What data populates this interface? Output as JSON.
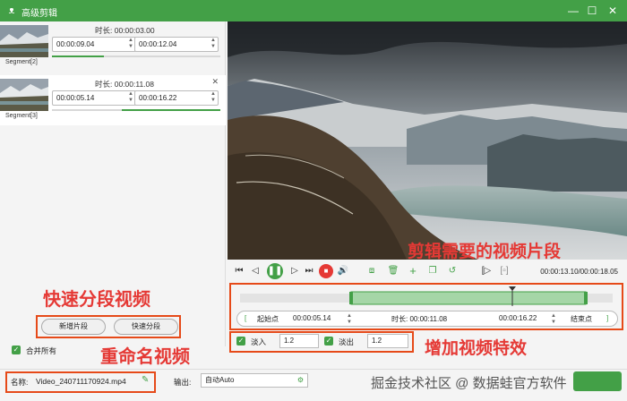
{
  "window": {
    "title": "高级剪辑",
    "minimize_icon": "minimize-icon",
    "maximize_icon": "maximize-icon",
    "close_icon": "close-icon"
  },
  "segments": [
    {
      "label": "Segment[2]",
      "duration_label": "时长: 00:00:03.00",
      "start": "00:00:09.04",
      "end": "00:00:12.04"
    },
    {
      "label": "Segment[3]",
      "duration_label": "时长: 00:00:11.08",
      "start": "00:00:05.14",
      "end": "00:00:16.22"
    }
  ],
  "left_actions": {
    "add_segment": "新增片段",
    "quick_segment": "快速分段",
    "merge_all": "合并所有"
  },
  "annotations": {
    "quick_segment": "快速分段视频",
    "rename": "重命名视频",
    "cut_segment": "剪辑需要的视频片段",
    "add_effects": "增加视频特效",
    "watermark": "掘金技术社区 @ 数据蛙官方软件"
  },
  "player": {
    "time_readout": "00:00:13.10/00:00:18.05"
  },
  "range": {
    "start_label": "起始点",
    "start_value": "00:00:05.14",
    "duration_label": "时长: 00:00:11.08",
    "end_value": "00:00:16.22",
    "end_label": "结束点"
  },
  "effects": {
    "fade_in_label": "淡入",
    "fade_in_value": "1.2",
    "fade_out_label": "淡出",
    "fade_out_value": "1.2"
  },
  "output": {
    "name_label": "名称:",
    "name_value": "Video_240711170924.mp4",
    "output_label": "输出:",
    "output_value": "自动Auto"
  },
  "colors": {
    "accent": "#43a047",
    "annotation": "#e53935"
  }
}
